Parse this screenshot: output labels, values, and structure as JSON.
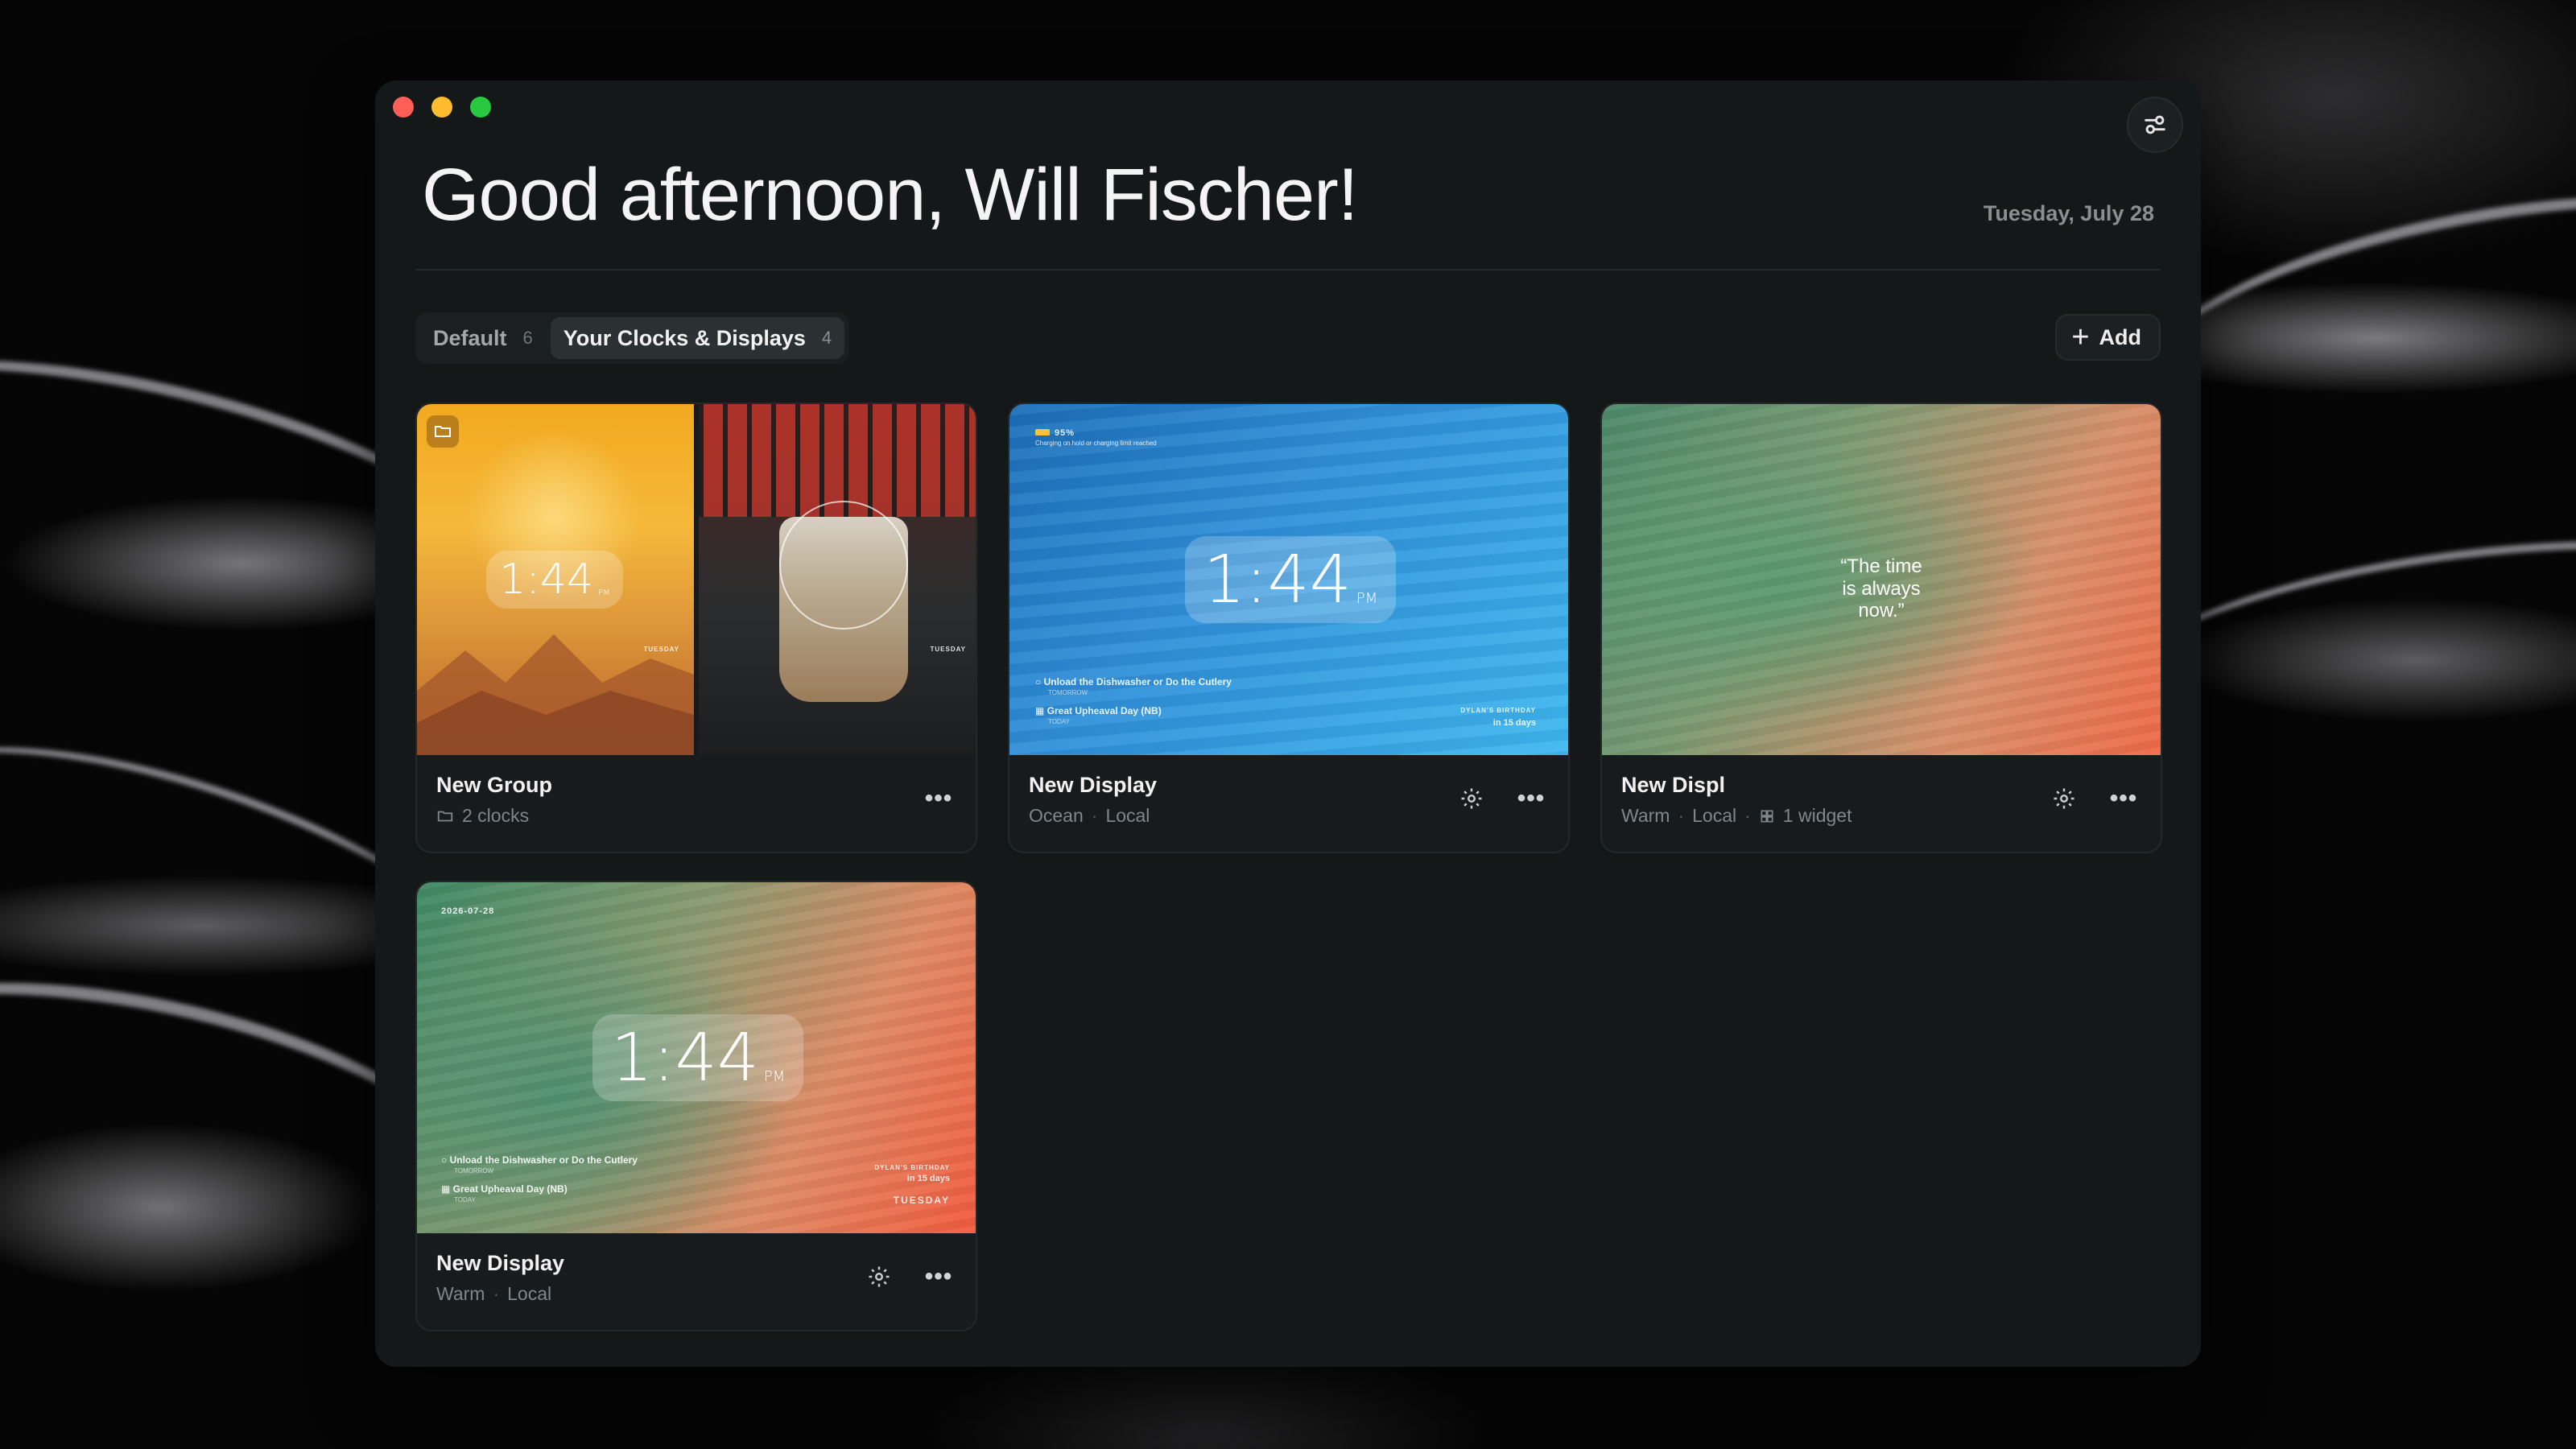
{
  "greeting": "Good afternoon, Will Fischer!",
  "date": "Tuesday, July 28",
  "tabs": [
    {
      "label": "Default",
      "count": "6"
    },
    {
      "label": "Your Clocks & Displays",
      "count": "4"
    }
  ],
  "add_label": "Add",
  "cards": [
    {
      "title": "New Group",
      "meta": "2 clocks",
      "thumb": {
        "time": "1:44",
        "ampm": "PM",
        "day": "TUESDAY",
        "day2": "TUESDAY"
      }
    },
    {
      "title": "New Display",
      "meta": [
        "Ocean",
        "Local"
      ],
      "thumb": {
        "time": "1:44",
        "ampm": "PM",
        "battery": "95%",
        "battery_note": "Charging on hold or charging limit reached",
        "task1": "Unload the Dishwasher or Do the Cutlery",
        "task1_sub": "TOMORROW",
        "task2": "Great Upheaval Day (NB)",
        "task2_sub": "TODAY",
        "event_label": "DYLAN'S BIRTHDAY",
        "event_when": "in 15 days"
      }
    },
    {
      "title": "New Displ",
      "meta": [
        "Warm",
        "Local",
        "1 widget"
      ],
      "thumb": {
        "quote": "“The time is always now.”"
      }
    },
    {
      "title": "New Display",
      "meta": [
        "Warm",
        "Local"
      ],
      "thumb": {
        "date": "2026-07-28",
        "time": "1:44",
        "ampm": "PM",
        "task1": "Unload the Dishwasher or Do the Cutlery",
        "task1_sub": "TOMORROW",
        "task2": "Great Upheaval Day (NB)",
        "task2_sub": "TODAY",
        "event_label": "DYLAN'S BIRTHDAY",
        "event_when": "in 15 days",
        "day": "TUESDAY"
      }
    }
  ],
  "icons": {
    "settings": "sliders-icon",
    "gear": "gear-icon",
    "more": "more-dots-icon",
    "folder": "folder-icon",
    "widget": "grid-icon"
  }
}
